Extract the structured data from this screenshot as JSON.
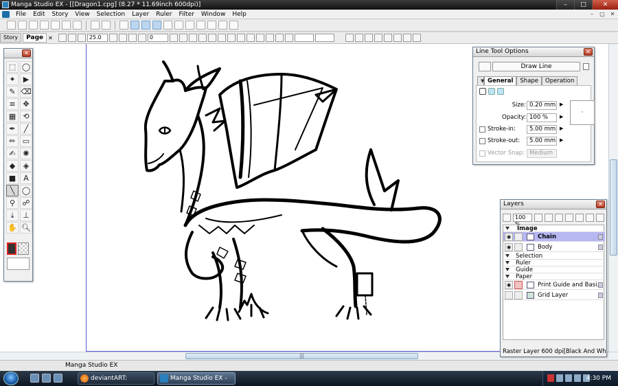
{
  "window": {
    "title": "Manga Studio EX - [[Dragon1.cpg] (8.27 * 11.69inch 600dpi)]",
    "min": "–",
    "max": "□",
    "close": "✕"
  },
  "menu": [
    "File",
    "Edit",
    "Story",
    "View",
    "Selection",
    "Layer",
    "Ruler",
    "Filter",
    "Window",
    "Help"
  ],
  "tabs": {
    "story": "Story",
    "page": "Page",
    "page_close": "✕"
  },
  "toolbar2": {
    "size_value": "25.0",
    "angle_value": "0"
  },
  "canvas": {
    "page_border_color": "#5d5bd6"
  },
  "tools_palette": {
    "close": "✕",
    "text_tool_glyph": "A"
  },
  "line_tool_options": {
    "title": "Line Tool Options",
    "close": "✕",
    "mode": "Draw Line",
    "tabs": [
      "General",
      "Shape",
      "Operation"
    ],
    "fields": {
      "size": {
        "label": "Size:",
        "value": "0.20 mm"
      },
      "opacity": {
        "label": "Opacity:",
        "value": "100 %"
      },
      "stroke_in": {
        "label": "Stroke-in:",
        "value": "5.00 mm"
      },
      "stroke_out": {
        "label": "Stroke-out:",
        "value": "5.00 mm"
      },
      "vector_snap": {
        "label": "Vector Snap:",
        "value": "Medium"
      }
    },
    "preview": "·"
  },
  "layers": {
    "title": "Layers",
    "close": "✕",
    "opacity": "100 %",
    "groups": {
      "image": "Image",
      "selection": "Selection",
      "ruler": "Ruler",
      "guide": "Guide",
      "paper": "Paper"
    },
    "items": {
      "chain": "Chain",
      "body": "Body",
      "print_guide": "Print Guide and Basi...",
      "grid": "Grid Layer"
    },
    "status": "Raster Layer 600 dpi[Black And White ..."
  },
  "statusbar": {
    "text": "Manga Studio EX"
  },
  "taskbar": {
    "buttons": [
      {
        "label": "deviantART: Messag..."
      },
      {
        "label": "Manga Studio EX - [..."
      }
    ],
    "clock": "4:30 PM"
  }
}
